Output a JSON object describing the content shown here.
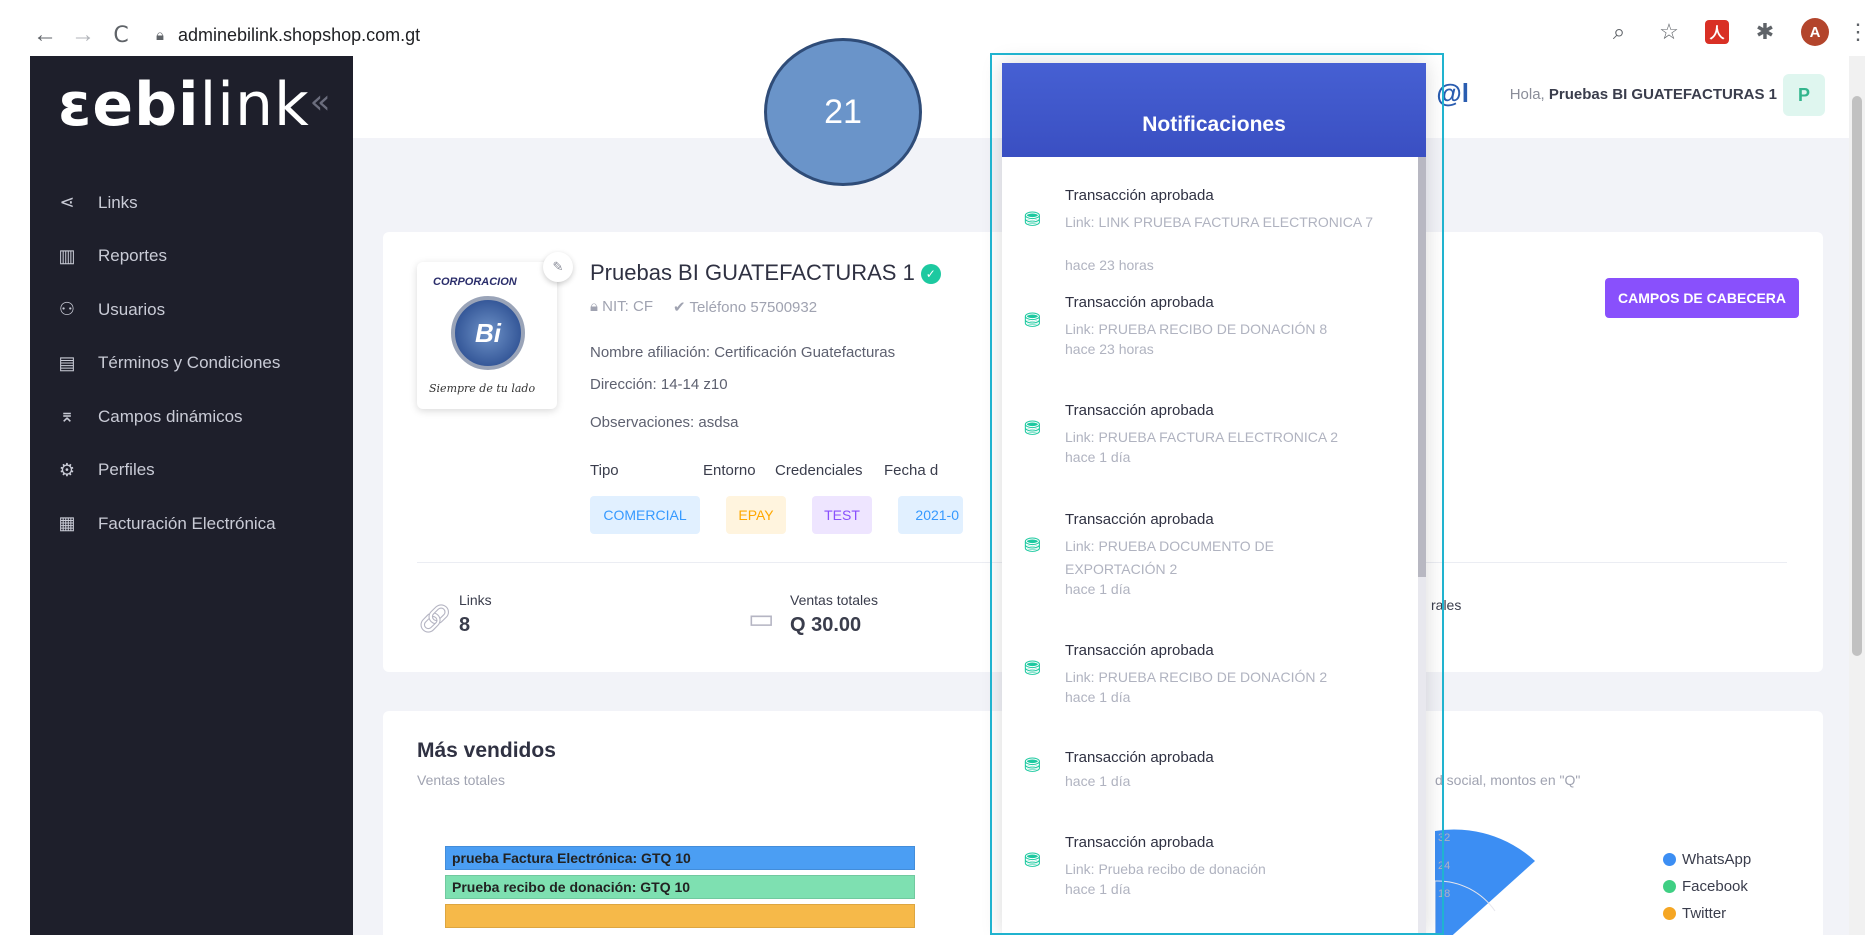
{
  "browser": {
    "back": "←",
    "forward": "→",
    "reload": "C",
    "url": "adminebilink.shopshop.com.gt",
    "zoom_icon": "⌕",
    "star_icon": "☆",
    "pdf_icon": "人",
    "ext_icon": "✱",
    "profile_initial": "A",
    "menu_icon": "⋮"
  },
  "sidebar": {
    "logo_bold": "ebi",
    "logo_prefix": "ɛ",
    "logo_light": "link",
    "collapse": "«",
    "items": [
      {
        "label": "Links",
        "icon": "⋖"
      },
      {
        "label": "Reportes",
        "icon": "▥"
      },
      {
        "label": "Usuarios",
        "icon": "⚇"
      },
      {
        "label": "Términos y Condiciones",
        "icon": "▤"
      },
      {
        "label": "Campos dinámicos",
        "icon": "⌆"
      },
      {
        "label": "Perfiles",
        "icon": "⚙"
      },
      {
        "label": "Facturación Electrónica",
        "icon": "▦"
      }
    ]
  },
  "header": {
    "greeting": "Hola,",
    "user": "Pruebas BI GUATEFACTURAS 1",
    "avatar": "P",
    "small_logo": "@l"
  },
  "company": {
    "logo_top": "CORPORACION",
    "logo_mid": "Bi",
    "logo_bottom": "Siempre de tu lado",
    "name": "Pruebas BI GUATEFACTURAS 1",
    "verified": "✓",
    "nit": "NIT: CF",
    "phone": "Teléfono 57500932",
    "affiliation": "Nombre afiliación: Certificación Guatefacturas",
    "address": "Dirección: 14-14 z10",
    "notes": "Observaciones: asdsa",
    "labels": {
      "tipo": "Tipo",
      "entorno": "Entorno",
      "credenciales": "Credenciales",
      "fecha": "Fecha d"
    },
    "tipo": "COMERCIAL",
    "entorno": "EPAY",
    "credenciales": "TEST",
    "fecha": "2021-0",
    "button": "CAMPOS DE CABECERA"
  },
  "stats": {
    "links_label": "Links",
    "links_value": "8",
    "sales_label": "Ventas totales",
    "sales_value": "Q 30.00",
    "partial": "rales"
  },
  "best_sellers": {
    "title": "Más vendidos",
    "subtitle": "Ventas totales",
    "bars": [
      "prueba Factura Electrónica: GTQ 10",
      "Prueba recibo de donación: GTQ 10",
      ""
    ],
    "social_sub": "d social, montos en \"Q\"",
    "radial_ticks": [
      "32",
      "24",
      "18"
    ],
    "legend": [
      {
        "name": "WhatsApp",
        "color": "#3c8ef3"
      },
      {
        "name": "Facebook",
        "color": "#3fcf83"
      },
      {
        "name": "Twitter",
        "color": "#f5a623"
      }
    ]
  },
  "step_number": "21",
  "notifications": {
    "title": "Notificaciones",
    "items": [
      {
        "title": "Transacción aprobada",
        "link": "Link: LINK PRUEBA FACTURA ELECTRONICA 7",
        "time": "hace 23 horas"
      },
      {
        "title": "Transacción aprobada",
        "link": "Link: PRUEBA RECIBO DE DONACIÓN 8",
        "time": "hace 23 horas"
      },
      {
        "title": "Transacción aprobada",
        "link": "Link: PRUEBA FACTURA ELECTRONICA 2",
        "time": "hace 1 día"
      },
      {
        "title": "Transacción aprobada",
        "link": "Link: PRUEBA DOCUMENTO DE EXPORTACIÓN 2",
        "time": "hace 1 día"
      },
      {
        "title": "Transacción aprobada",
        "link": "Link: PRUEBA RECIBO DE DONACIÓN 2",
        "time": "hace 1 día"
      },
      {
        "title": "Transacción aprobada",
        "link": "",
        "time": "hace 1 día"
      },
      {
        "title": "Transacción aprobada",
        "link": "Link: Prueba recibo de donación",
        "time": "hace 1 día"
      }
    ]
  }
}
